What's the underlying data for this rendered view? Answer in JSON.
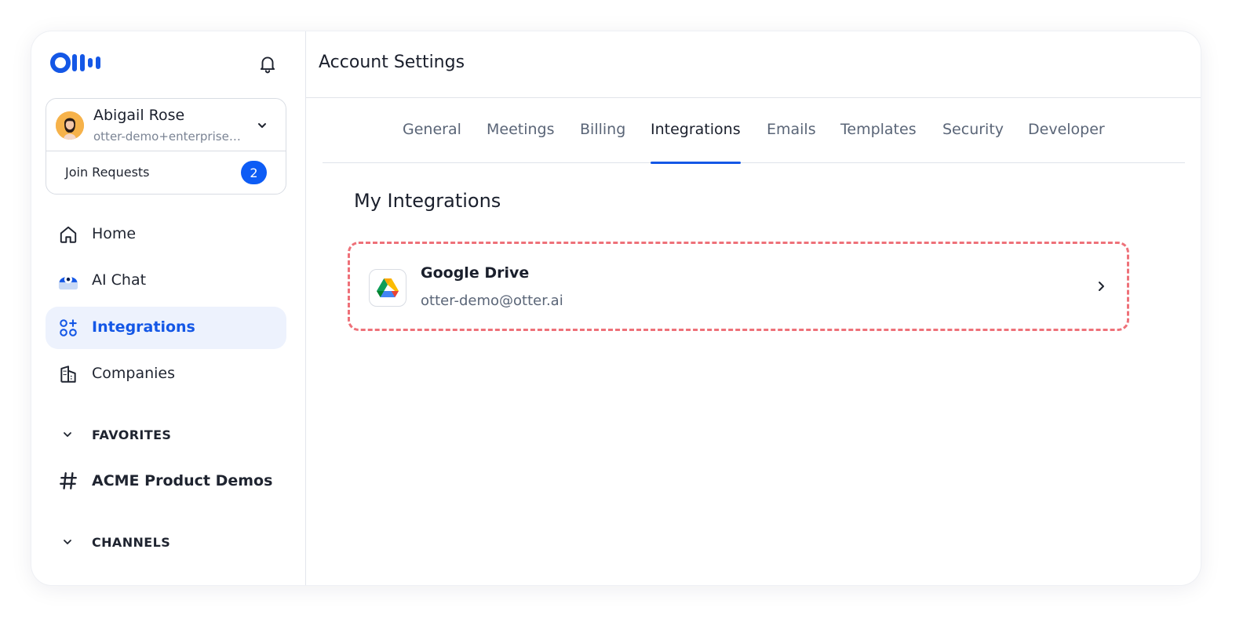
{
  "brand": {
    "logo": "Otter",
    "accent": "#1457e6"
  },
  "header": {
    "title": "Account Settings"
  },
  "user": {
    "name": "Abigail Rose",
    "email": "otter-demo+enterprise@otter.ai",
    "join_requests_label": "Join Requests",
    "join_requests_count": "2"
  },
  "sidebar": {
    "items": [
      {
        "label": "Home",
        "icon": "home-icon"
      },
      {
        "label": "AI Chat",
        "icon": "ai-chat-icon"
      },
      {
        "label": "Integrations",
        "icon": "integrations-icon",
        "active": true
      },
      {
        "label": "Companies",
        "icon": "companies-icon"
      }
    ],
    "favorites_label": "FAVORITES",
    "favorites": [
      {
        "label": "ACME Product Demos",
        "icon": "hash-icon"
      }
    ],
    "channels_label": "CHANNELS"
  },
  "tabs": [
    "General",
    "Meetings",
    "Billing",
    "Integrations",
    "Emails",
    "Templates",
    "Security",
    "Developer"
  ],
  "active_tab": "Integrations",
  "main": {
    "section_title": "My Integrations",
    "integrations": [
      {
        "name": "Google Drive",
        "account": "otter-demo@otter.ai",
        "icon": "google-drive-icon"
      }
    ]
  }
}
